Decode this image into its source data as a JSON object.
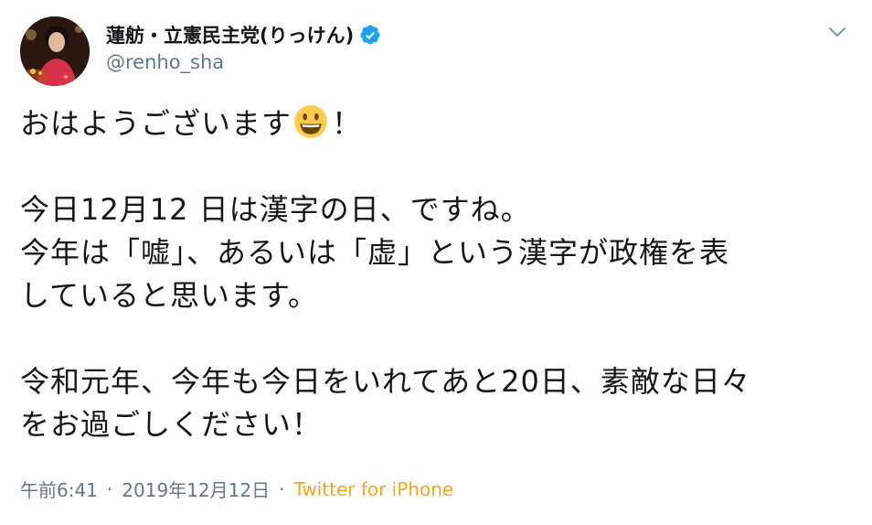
{
  "author": {
    "display_name": "蓮舫・立憲民主党(りっけん)",
    "handle": "@renho_sha",
    "verified": true
  },
  "tweet": {
    "lines": [
      "おはようございます",
      "",
      "今日12月12 日は漢字の日、ですね。",
      "今年は「嘘」、あるいは「虚」という漢字が政権を表",
      "していると思います。",
      "",
      "令和元年、今年も今日をいれてあと20日、素敵な日々",
      "をお過ごしください！"
    ],
    "first_line_suffix": "！",
    "emoji": "smiling-face-emoji"
  },
  "meta": {
    "time": "午前6:41",
    "separator": "·",
    "date": "2019年12月12日",
    "source": "Twitter for iPhone"
  },
  "colors": {
    "text": "#14171a",
    "secondary": "#657786",
    "verified_blue": "#1da1f2",
    "source_link": "#f5a623"
  }
}
